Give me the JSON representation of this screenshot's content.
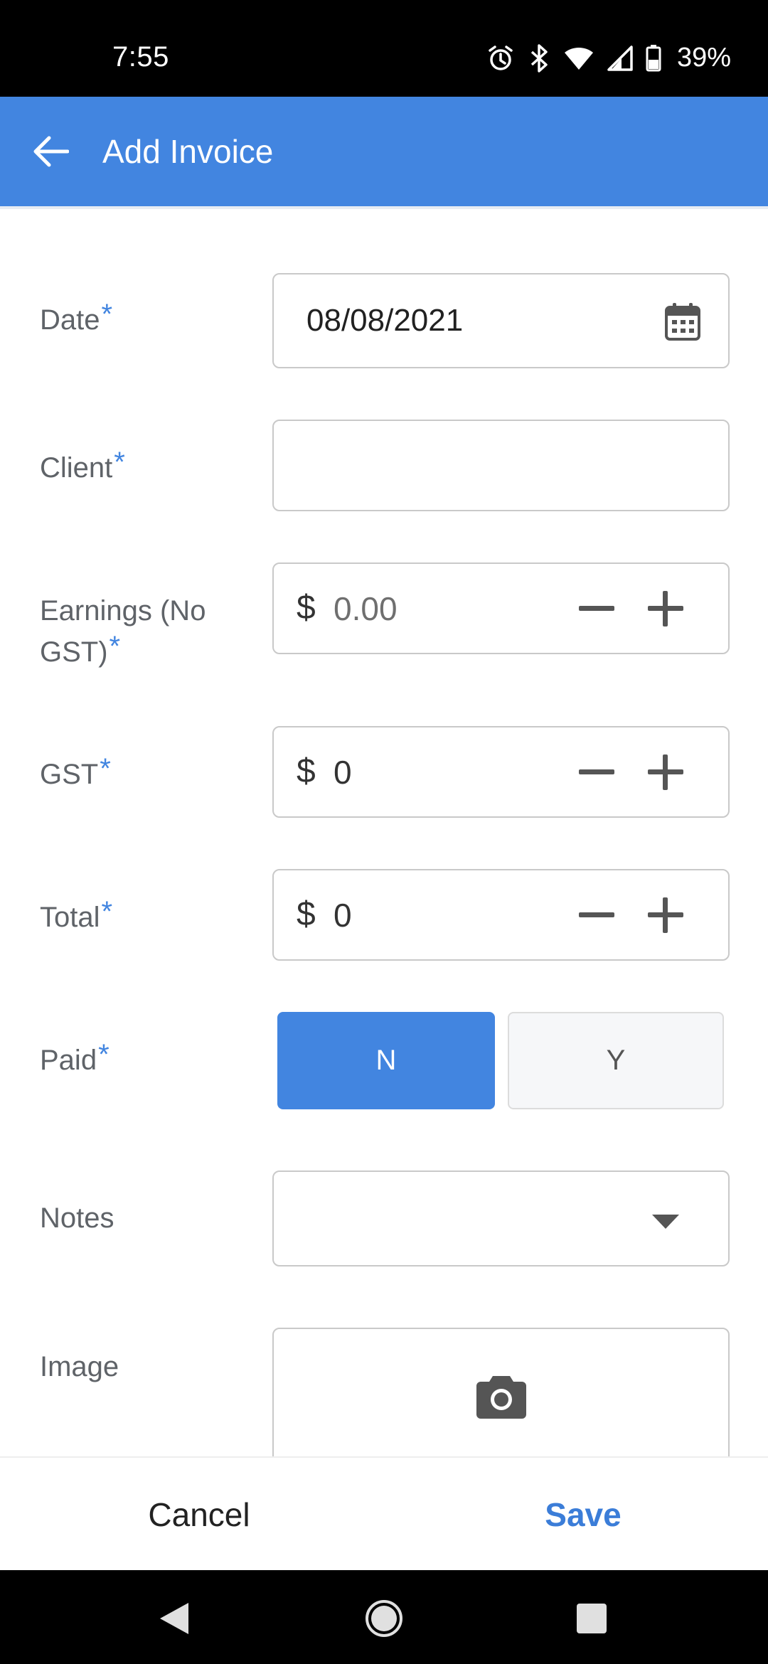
{
  "status_bar": {
    "time": "7:55",
    "battery_percent": "39%",
    "icons": [
      "alarm-icon",
      "bluetooth-icon",
      "wifi-icon",
      "signal-icon",
      "battery-icon"
    ]
  },
  "app_bar": {
    "title": "Add Invoice",
    "back_icon": "arrow-left-icon",
    "background": "#4285e0"
  },
  "form": {
    "date": {
      "label": "Date",
      "required_mark": "*",
      "value": "08/08/2021",
      "icon": "calendar-icon"
    },
    "client": {
      "label": "Client",
      "required_mark": "*",
      "value": ""
    },
    "earnings": {
      "label_line1": "Earnings (No",
      "label_line2": "GST)",
      "required_mark": "*",
      "currency": "$",
      "value": "0.00"
    },
    "gst": {
      "label": "GST",
      "required_mark": "*",
      "currency": "$",
      "value": "0"
    },
    "total": {
      "label": "Total",
      "required_mark": "*",
      "currency": "$",
      "value": "0"
    },
    "paid": {
      "label": "Paid",
      "required_mark": "*",
      "options": [
        "N",
        "Y"
      ],
      "selected": "N"
    },
    "notes": {
      "label": "Notes",
      "value": "",
      "icon": "dropdown-arrow-icon"
    },
    "image": {
      "label": "Image",
      "icon": "camera-icon"
    }
  },
  "actions": {
    "cancel_label": "Cancel",
    "save_label": "Save",
    "save_color": "#3b7dd8"
  },
  "nav_bar": {
    "icons": [
      "back-triangle-icon",
      "home-circle-icon",
      "recents-square-icon"
    ]
  }
}
